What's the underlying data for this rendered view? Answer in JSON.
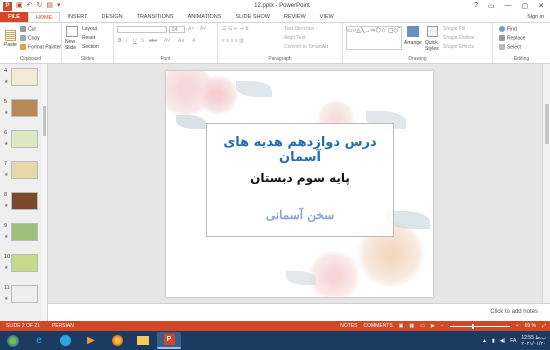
{
  "window": {
    "title": "12.pptx - PowerPoint",
    "signin": "Sign in",
    "controls": [
      "?",
      "▭",
      "—",
      "▢",
      "✕"
    ]
  },
  "tabs": [
    "FILE",
    "HOME",
    "INSERT",
    "DESIGN",
    "TRANSITIONS",
    "ANIMATIONS",
    "SLIDE SHOW",
    "REVIEW",
    "VIEW"
  ],
  "ribbon": {
    "clipboard": {
      "label": "Clipboard",
      "paste": "Paste",
      "cut": "Cut",
      "copy": "Copy",
      "format_painter": "Format Painter"
    },
    "slides": {
      "label": "Slides",
      "new_slide": "New",
      "new_slide2": "Slide",
      "layout": "Layout",
      "reset": "Reset",
      "section": "Section"
    },
    "font": {
      "label": "Font",
      "size": "24",
      "bold": "B",
      "italic": "I",
      "underline": "U",
      "strike": "S",
      "shadow": "abc",
      "spacing": "AV",
      "case": "Aa",
      "color": "A"
    },
    "paragraph": {
      "label": "Paragraph",
      "text_direction": "Text Direction",
      "align_text": "Align Text",
      "smartart": "Convert to SmartArt"
    },
    "drawing": {
      "label": "Drawing",
      "arrange": "Arrange",
      "quick_styles": "Quick",
      "quick_styles2": "Styles",
      "shape_fill": "Shape Fill",
      "shape_outline": "Shape Outline",
      "shape_effects": "Shape Effects"
    },
    "editing": {
      "label": "Editing",
      "find": "Find",
      "replace": "Replace",
      "select": "Select"
    }
  },
  "thumbnails": [
    {
      "num": "4",
      "color": "#f3e9d9"
    },
    {
      "num": "5",
      "color": "#b88a5a"
    },
    {
      "num": "6",
      "color": "#dce8c4"
    },
    {
      "num": "7",
      "color": "#e8d7a8"
    },
    {
      "num": "8",
      "color": "#7a4a2a"
    },
    {
      "num": "9",
      "color": "#9cc07a"
    },
    {
      "num": "10",
      "color": "#c9d98a"
    },
    {
      "num": "11",
      "color": "#eeeeee"
    }
  ],
  "slide": {
    "title": "درس دوازدهم هدیه های آسمان",
    "subtitle": "پایه سوم دبستان",
    "brand": "سخن آسمانی"
  },
  "notes_placeholder": "Click to add notes",
  "status": {
    "slide_of": "SLIDE 2 OF 21",
    "language": "PERSIAN",
    "notes": "NOTES",
    "comments": "COMMENTS",
    "zoom": "69 %"
  },
  "taskbar": {
    "lang": "FA",
    "time": "12:55 ب.ظ",
    "date": "۲۰۲۱/۰۱/۲۰"
  },
  "colors": {
    "accent": "#d24726",
    "taskbar": "#1c3b63",
    "title_blue": "#1f6fb5"
  }
}
